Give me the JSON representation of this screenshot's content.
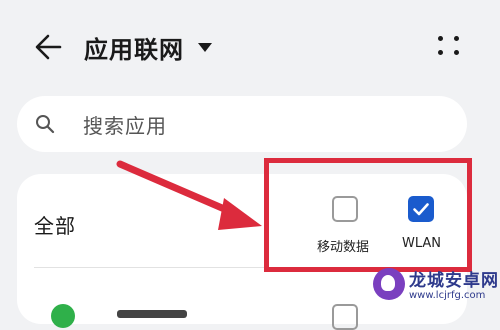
{
  "header": {
    "title": "应用联网",
    "back_icon": "arrow-left-icon",
    "dropdown_icon": "triangle-down-icon",
    "more_icon": "more-dots-icon"
  },
  "search": {
    "placeholder": "搜索应用",
    "icon": "search-icon"
  },
  "list": {
    "all_label": "全部",
    "columns": [
      {
        "label": "移动数据",
        "checked": false
      },
      {
        "label": "WLAN",
        "checked": true
      }
    ]
  },
  "annotation": {
    "highlight_color": "#dc2b3d"
  },
  "watermark": {
    "name": "龙城安卓网",
    "url": "www.lcjrfg.com"
  },
  "colors": {
    "accent": "#1a5bcd",
    "background": "#f1f2f4"
  }
}
